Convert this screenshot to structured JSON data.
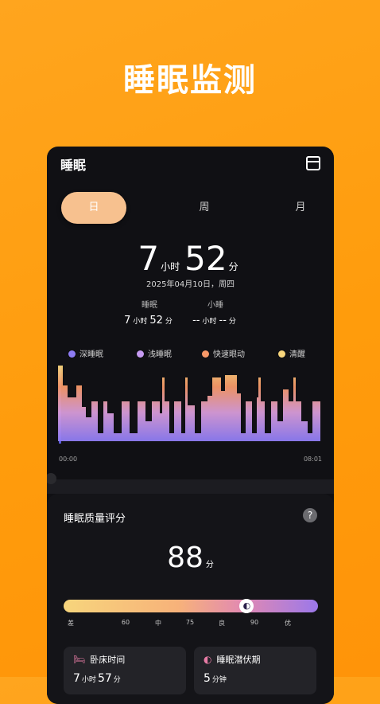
{
  "hero_title": "睡眠监测",
  "app": {
    "title": "睡眠",
    "tabs": [
      {
        "label": "日",
        "active": true
      },
      {
        "label": "周",
        "active": false
      },
      {
        "label": "月",
        "active": false
      }
    ],
    "total_hours": "7",
    "hours_unit": "小时",
    "total_minutes": "52",
    "minutes_unit": "分",
    "date_text": "2025年04月10日，周四",
    "sleep_stat": {
      "label": "睡眠",
      "hours": "7",
      "hours_unit": "小时",
      "minutes": "52",
      "minutes_unit": "分"
    },
    "nap_stat": {
      "label": "小睡",
      "hours": "--",
      "hours_unit": "小时",
      "minutes": "--",
      "minutes_unit": "分"
    },
    "legend": [
      {
        "label": "深睡眠",
        "color": "#8e7cf4"
      },
      {
        "label": "浅睡眠",
        "color": "#c69bf2"
      },
      {
        "label": "快速眼动",
        "color": "#f79868"
      },
      {
        "label": "清醒",
        "color": "#f7d57c"
      }
    ],
    "chart_start": "00:00",
    "chart_end": "08:01",
    "quality": {
      "title": "睡眠质量评分",
      "help_icon": "?",
      "score": "88",
      "score_unit": "分",
      "score_fraction": 0.72,
      "marker_icon": "moon-icon",
      "scale_labels": [
        "差",
        "60",
        "中",
        "75",
        "良",
        "90",
        "优"
      ]
    },
    "bed_time": {
      "label": "卧床时间",
      "icon": "bed-icon",
      "hours": "7",
      "hours_unit": "小时",
      "minutes": "57",
      "minutes_unit": "分"
    },
    "latency": {
      "label": "睡眠潜伏期",
      "icon": "latency-icon",
      "minutes": "5",
      "minutes_unit": "分钟"
    }
  }
}
